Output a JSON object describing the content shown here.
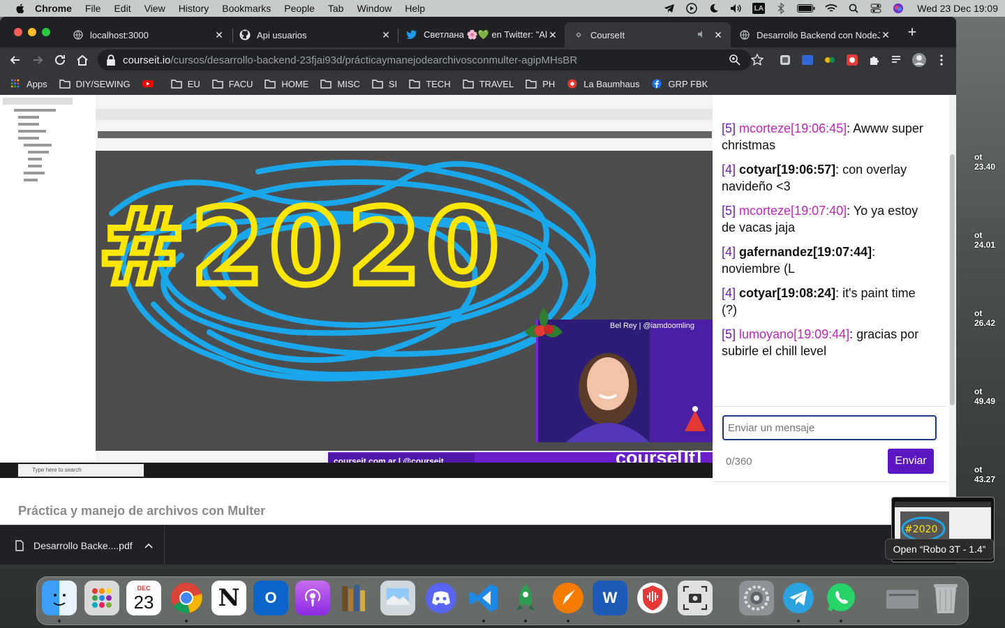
{
  "menubar": {
    "app_name": "Chrome",
    "items": [
      "File",
      "Edit",
      "View",
      "History",
      "Bookmarks",
      "People",
      "Tab",
      "Window",
      "Help"
    ],
    "status_icons": [
      "telegram-icon",
      "play-icon",
      "moon-icon",
      "volume-icon",
      "keyboard-la-icon",
      "bluetooth-off-icon",
      "battery-icon",
      "wifi-icon",
      "search-icon",
      "control-center-icon",
      "siri-icon"
    ],
    "keyboard_label": "LA",
    "clock": "Wed 23 Dec  19:09"
  },
  "tabs": [
    {
      "title": "localhost:3000",
      "icon": "globe-icon"
    },
    {
      "title": "Api usuarios",
      "icon": "github-icon"
    },
    {
      "title": "Светлана 🌸💚 en Twitter: \"Al",
      "icon": "twitter-icon"
    },
    {
      "title": "CourseIt",
      "icon": "loading-icon",
      "active": true
    },
    {
      "title": "Desarrollo Backend con NodeJ",
      "icon": "globe-icon"
    }
  ],
  "omnibox": {
    "host": "courseit.io",
    "path": "/cursos/desarrollo-backend-23fjai93d/prácticaymanejodearchivosconmulter-agipMHsBR"
  },
  "bookmarks": [
    {
      "label": "Apps",
      "icon": "apps-grid-icon"
    },
    {
      "label": "DIY/SEWING",
      "icon": "folder-icon"
    },
    {
      "label": "",
      "icon": "youtube-icon"
    },
    {
      "label": "EU",
      "icon": "folder-icon"
    },
    {
      "label": "FACU",
      "icon": "folder-icon"
    },
    {
      "label": "HOME",
      "icon": "folder-icon"
    },
    {
      "label": "MISC",
      "icon": "folder-icon"
    },
    {
      "label": "SI",
      "icon": "folder-icon"
    },
    {
      "label": "TECH",
      "icon": "folder-icon"
    },
    {
      "label": "TRAVEL",
      "icon": "folder-icon"
    },
    {
      "label": "PH",
      "icon": "folder-icon"
    },
    {
      "label": "La Baumhaus",
      "icon": "record-icon"
    },
    {
      "label": "GRP FBK",
      "icon": "facebook-icon"
    }
  ],
  "video": {
    "drawing_text": "#2020",
    "cam_label": "Bel Rey | @iamdoomling",
    "brand_left": "courseit.com.ar  |  @courseit_",
    "brand_name": "course[It]",
    "windows_search": "Type here to search"
  },
  "chat": {
    "messages": [
      {
        "level": "[5]",
        "user": "mcorteze[19:06:45]",
        "style": "pink",
        "text": ": Awww super christmas"
      },
      {
        "level": "[4]",
        "user": "cotyar[19:06:57]",
        "style": "plain",
        "text": ": con overlay navideño <3"
      },
      {
        "level": "[5]",
        "user": "mcorteze[19:07:40]",
        "style": "pink",
        "text": ": Yo ya estoy de vacas jaja"
      },
      {
        "level": "[4]",
        "user": "gafernandez[19:07:44]",
        "style": "plain",
        "text": ": noviembre (L"
      },
      {
        "level": "[4]",
        "user": "cotyar[19:08:24]",
        "style": "plain",
        "text": ": it's paint time (?)"
      },
      {
        "level": "[5]",
        "user": "lumoyano[19:09:44]",
        "style": "pink",
        "text": ": gracias por subirle el chill level"
      }
    ],
    "input_placeholder": "Enviar un mensaje",
    "counter": "0/360",
    "send_label": "Enviar"
  },
  "lesson_title": "Práctica y manejo de archivos con Multer",
  "download": {
    "filename": "Desarrollo Backe....pdf"
  },
  "dock": {
    "calendar_month": "DEC",
    "calendar_day": "23",
    "tooltip": "Open “Robo 3T - 1.4”"
  },
  "side_labels": [
    "ot 23.40",
    "ot 24.01",
    "ot 26.42",
    "ot 49.49",
    "ot 43.27"
  ],
  "colors": {
    "accent": "#5b16c2",
    "level": "#6b21a8",
    "user_pink": "#c026b8",
    "drawing_yellow": "#ffe600",
    "drawing_blue": "#1aa7ec"
  }
}
